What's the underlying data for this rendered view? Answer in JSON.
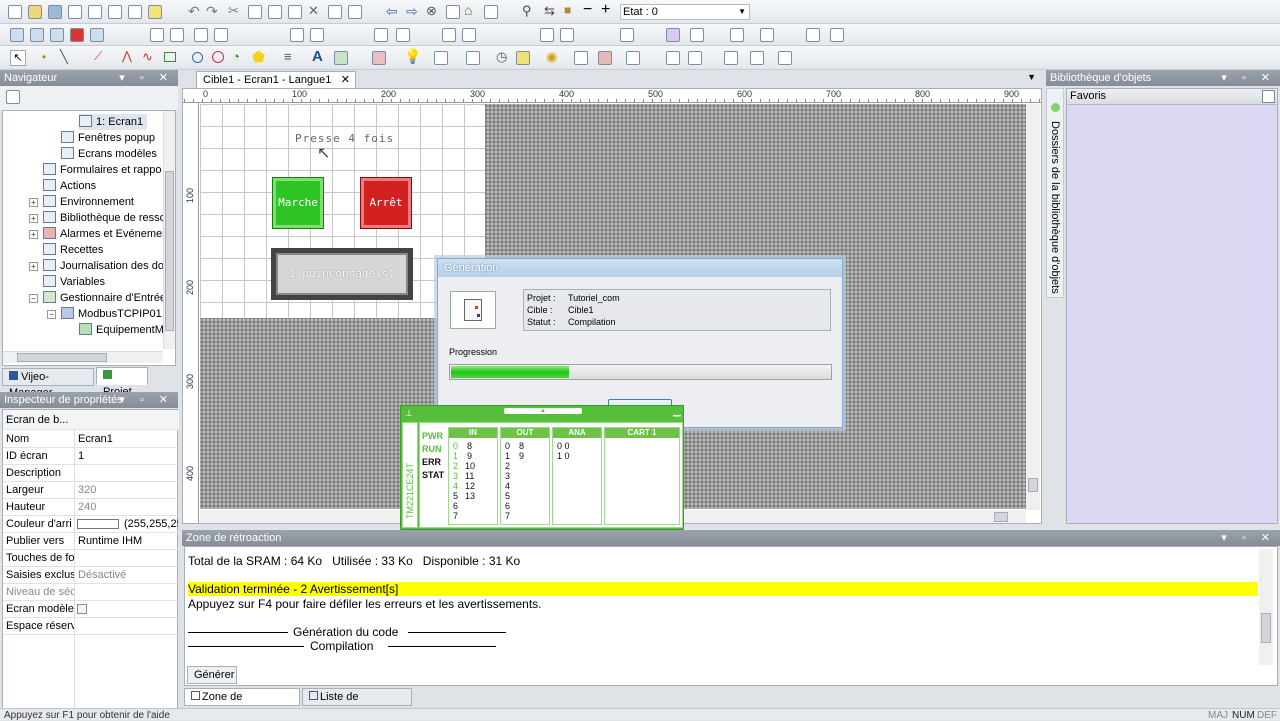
{
  "toolbar": {
    "etat_label": "Etat : 0"
  },
  "navigator": {
    "title": "Navigateur",
    "items": [
      {
        "label": "1: Ecran1"
      },
      {
        "label": "Fenêtres popup"
      },
      {
        "label": "Ecrans modèles"
      },
      {
        "label": "Formulaires et rappo"
      },
      {
        "label": "Actions"
      },
      {
        "label": "Environnement"
      },
      {
        "label": "Bibliothèque de resso"
      },
      {
        "label": "Alarmes et Evénemer"
      },
      {
        "label": "Recettes"
      },
      {
        "label": "Journalisation des do"
      },
      {
        "label": "Variables"
      },
      {
        "label": "Gestionnaire d'Entrée"
      },
      {
        "label": "ModbusTCPIP01"
      },
      {
        "label": "EquipementM"
      }
    ],
    "tabs": [
      {
        "label": "Vijeo-Manager"
      },
      {
        "label": "Projet"
      }
    ]
  },
  "inspector": {
    "title": "Inspecteur de propriétés",
    "header": "Ecran de b...",
    "rows": [
      {
        "key": "Nom",
        "value": "Ecran1"
      },
      {
        "key": "ID écran",
        "value": "1"
      },
      {
        "key": "Description",
        "value": ""
      },
      {
        "key": "Largeur",
        "value": "320"
      },
      {
        "key": "Hauteur",
        "value": "240"
      },
      {
        "key": "Couleur d'arri",
        "value": "(255,255,25"
      },
      {
        "key": "Publier vers",
        "value": "Runtime IHM"
      },
      {
        "key": "Touches de fo",
        "value": ""
      },
      {
        "key": "Saisies exclusi",
        "value": "Désactivé"
      },
      {
        "key": "Niveau de séc",
        "value": ""
      },
      {
        "key": "Ecran modèle",
        "value": ""
      },
      {
        "key": "Espace réservé",
        "value": ""
      }
    ]
  },
  "editor": {
    "tab_label": "Cible1 - Ecran1 - Langue1",
    "ruler_top": [
      "0",
      "100",
      "200",
      "300",
      "400",
      "500",
      "600",
      "700",
      "800",
      "900"
    ],
    "ruler_left": [
      "100",
      "200",
      "300",
      "400"
    ],
    "canvas": {
      "presse_text": "Presse 4 fois",
      "marche_label": "Marche",
      "arret_label": "Arrêt",
      "counter_text": "1 poinçonnage(s)"
    }
  },
  "library": {
    "title": "Bibliothèque d'objets",
    "favoris": "Favoris",
    "side_tab": "Dossiers de la bibliothèque d'objets"
  },
  "dialog": {
    "title": "Génération",
    "projet_key": "Projet :",
    "projet_val": "Tutoriel_com",
    "cible_key": "Cible :",
    "cible_val": "Cible1",
    "statut_key": "Statut :",
    "statut_val": "Compilation",
    "progress_label": "Progression",
    "progress": 0.31
  },
  "plc": {
    "model": "TM221CE24T",
    "status": [
      "PWR",
      "RUN",
      "ERR",
      "STAT"
    ],
    "headers": [
      "IN",
      "OUT",
      "ANA",
      "CART 1"
    ],
    "in_left": [
      "0",
      "1",
      "2",
      "3",
      "4",
      "5",
      "6",
      "7"
    ],
    "in_right": [
      "8",
      "9",
      "10",
      "11",
      "12",
      "13"
    ],
    "out_left": [
      "0",
      "1",
      "2",
      "3",
      "4",
      "5",
      "6",
      "7"
    ],
    "out_right": [
      "8",
      "9"
    ],
    "ana": [
      "0 0",
      "1 0"
    ]
  },
  "feedback": {
    "title": "Zone de rétroaction",
    "line1": "Total de la SRAM : 64 Ko   Utilisée : 33 Ko   Disponible : 31 Ko",
    "line_highlight": "Validation terminée - 2 Avertissement[s]",
    "line3": "Appuyez sur F4 pour faire défiler les erreurs et les avertissements.",
    "line4": "Génération du code",
    "line5": "Compilation",
    "inner_tab": "Générer",
    "tabs": [
      {
        "label": "Zone de rétroaction"
      },
      {
        "label": "Liste de graphiques"
      }
    ]
  },
  "statusbar": {
    "help": "Appuyez sur F1 pour obtenir de l'aide",
    "maj": "MAJ",
    "num": "NUM",
    "def": "DEF"
  },
  "colors": {
    "accent_green": "#55bf3b",
    "highlight_yellow": "#ffff00",
    "marche_green": "#2ec425",
    "arret_red": "#d42020"
  }
}
